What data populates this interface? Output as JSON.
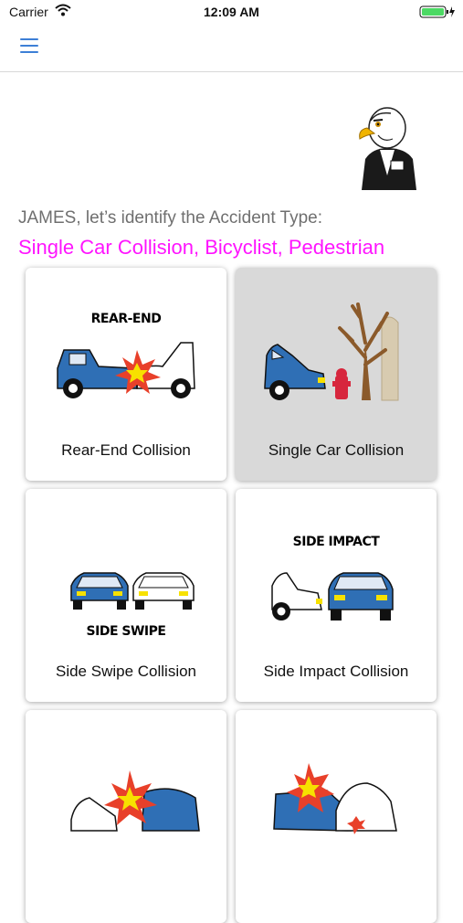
{
  "status_bar": {
    "carrier": "Carrier",
    "time": "12:09 AM"
  },
  "header": {
    "menu_icon": "hamburger-icon"
  },
  "mascot": {
    "icon": "eagle-mascot-icon"
  },
  "prompt": {
    "text": "JAMES, let’s identify the Accident Type:"
  },
  "selected_type": {
    "text": "Single Car Collision, Bicyclist, Pedestrian",
    "color": "#ff14ff"
  },
  "cards": [
    {
      "label": "Rear-End Collision",
      "caption": "REAR-END",
      "selected": false
    },
    {
      "label": "Single Car Collision",
      "caption": "",
      "selected": true
    },
    {
      "label": "Side Swipe Collision",
      "caption": "SIDE SWIPE",
      "selected": false
    },
    {
      "label": "Side Impact Collision",
      "caption": "SIDE IMPACT",
      "selected": false
    },
    {
      "label": "",
      "caption": "",
      "selected": false
    },
    {
      "label": "",
      "caption": "",
      "selected": false
    }
  ],
  "colors": {
    "accent": "#3d7fd6",
    "car_blue": "#2f6fb5",
    "selected_card": "#d9d9d9"
  }
}
